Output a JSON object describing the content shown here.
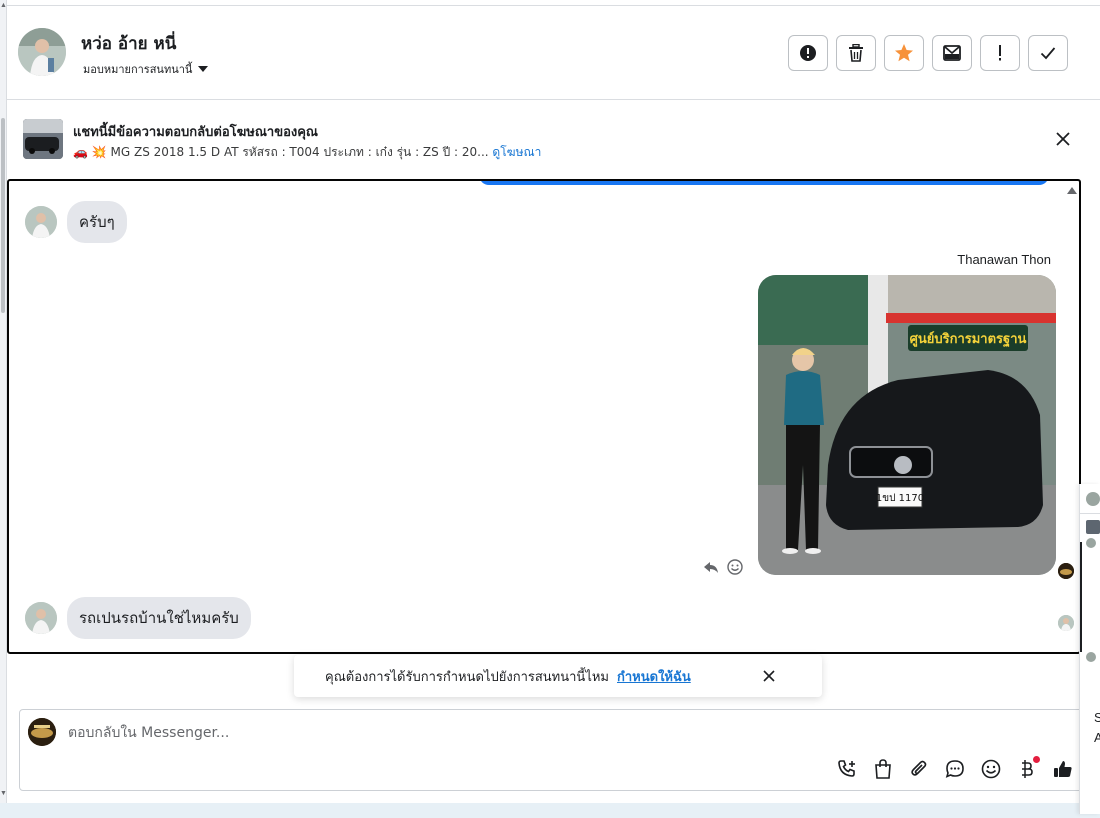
{
  "header": {
    "contact_name": "หว่อ อ้าย หนี่",
    "assign_label": "มอบหมายการสนทนานี้",
    "accent_color": "#f7923a"
  },
  "actions": [
    {
      "name": "alert-circle-icon"
    },
    {
      "name": "trash-icon"
    },
    {
      "name": "star-icon"
    },
    {
      "name": "mark-unread-icon"
    },
    {
      "name": "exclamation-icon"
    },
    {
      "name": "check-icon"
    }
  ],
  "ad": {
    "title": "แชทนี้มีข้อความตอบกลับต่อโฆษณาของคุณ",
    "description": "🚗 💥 MG ZS 2018 1.5 D AT รหัสรถ : T004 ประเภท : เก๋ง รุ่น : ZS ปี : 20...",
    "link_label": "ดูโฆษณา"
  },
  "thread": {
    "messages": [
      {
        "from": "contact",
        "text": "ครับๆ"
      },
      {
        "from": "page",
        "sender": "Thanawan Thon",
        "image": "photo"
      },
      {
        "from": "contact",
        "text": "รถเปนรถบ้านใช่ไหมครับ"
      }
    ],
    "photo_sign_text": "ศูนย์บริการมาตรฐาน",
    "photo_plate_text": "1ขป 1170"
  },
  "toast": {
    "text": "คุณต้องการได้รับการกำหนดไปยังการสนทนานี้ไหม",
    "link_label": "กำหนดให้ฉัน"
  },
  "composer": {
    "placeholder": "ตอบกลับใน Messenger...",
    "tools": [
      "phone-plus-icon",
      "shopping-bag-icon",
      "paperclip-icon",
      "chat-bubble-icon",
      "emoji-icon",
      "baht-icon",
      "thumbs-up-icon"
    ]
  },
  "right_panel": {
    "letters": [
      "S",
      "A"
    ]
  }
}
